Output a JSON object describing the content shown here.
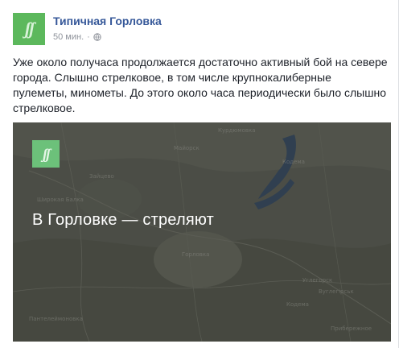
{
  "post": {
    "page_name": "Типичная Горловка",
    "timestamp": "50 мин.",
    "separator": "·",
    "privacy_icon": "globe-icon",
    "avatar_icon": "page-logo-icon",
    "text": "Уже около получаса продолжается достаточно активный бой на севере города. Слышно стрелковое, в том числе крупнокалиберные пулеметы, минометы. До этого около часа периодически было слышно стрелковое."
  },
  "media": {
    "headline": "В Горловке — стреляют",
    "logo_icon": "page-logo-icon",
    "map_labels": [
      "Курдюмовка",
      "Кодема",
      "Зайцево",
      "Майорск",
      "Широкая Балка",
      "Горловка",
      "Углегорск",
      "Кодема",
      "Вуглегірськ",
      "Пантелеймоновка",
      "Прибережное"
    ]
  },
  "colors": {
    "brand_green": "#5cb85c",
    "link_blue": "#365899",
    "meta_gray": "#90949c"
  }
}
